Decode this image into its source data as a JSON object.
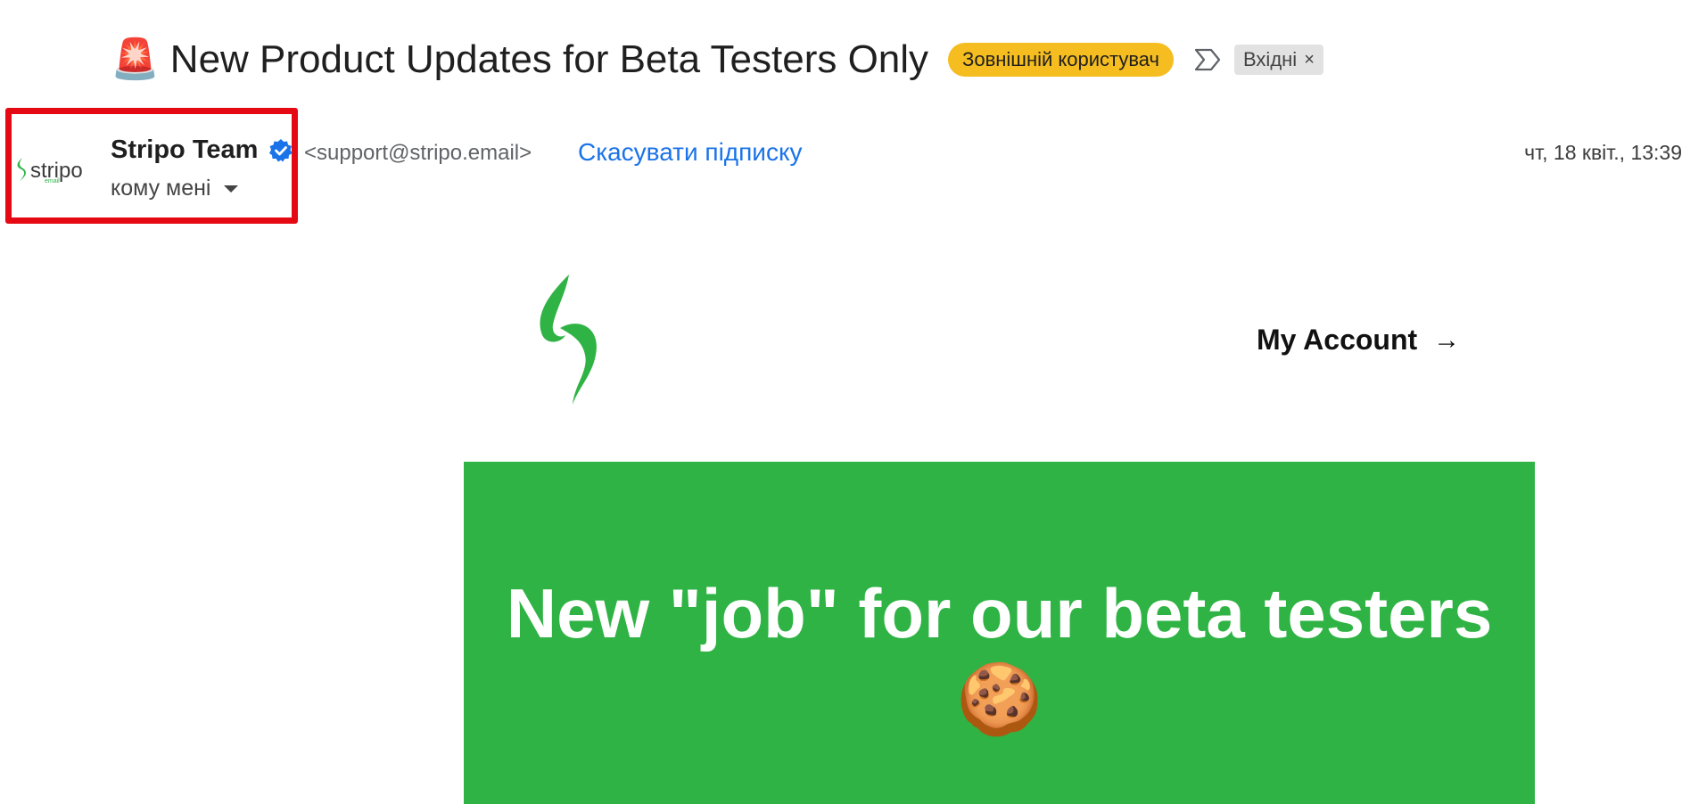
{
  "header": {
    "subject_emoji": "🚨",
    "subject": "New Product Updates for Beta Testers Only",
    "external_badge": "Зовнішній користувач",
    "label": "Вхідні",
    "label_remove": "×"
  },
  "sender": {
    "logo_text": "stripo",
    "logo_sub": "email",
    "name": "Stripo Team",
    "email": "<support@stripo.email>",
    "unsubscribe": "Скасувати підписку",
    "date": "чт, 18 квіт., 13:39",
    "to": "кому мені"
  },
  "email_body": {
    "my_account": "My Account",
    "my_account_arrow": "→",
    "banner_title": "New \"job\" for our beta testers🍪",
    "banner_color": "#2fb344"
  },
  "icons": [
    "siren-emoji",
    "important-marker-icon",
    "verified-icon",
    "chevron-down-icon",
    "stripo-logo-icon"
  ]
}
